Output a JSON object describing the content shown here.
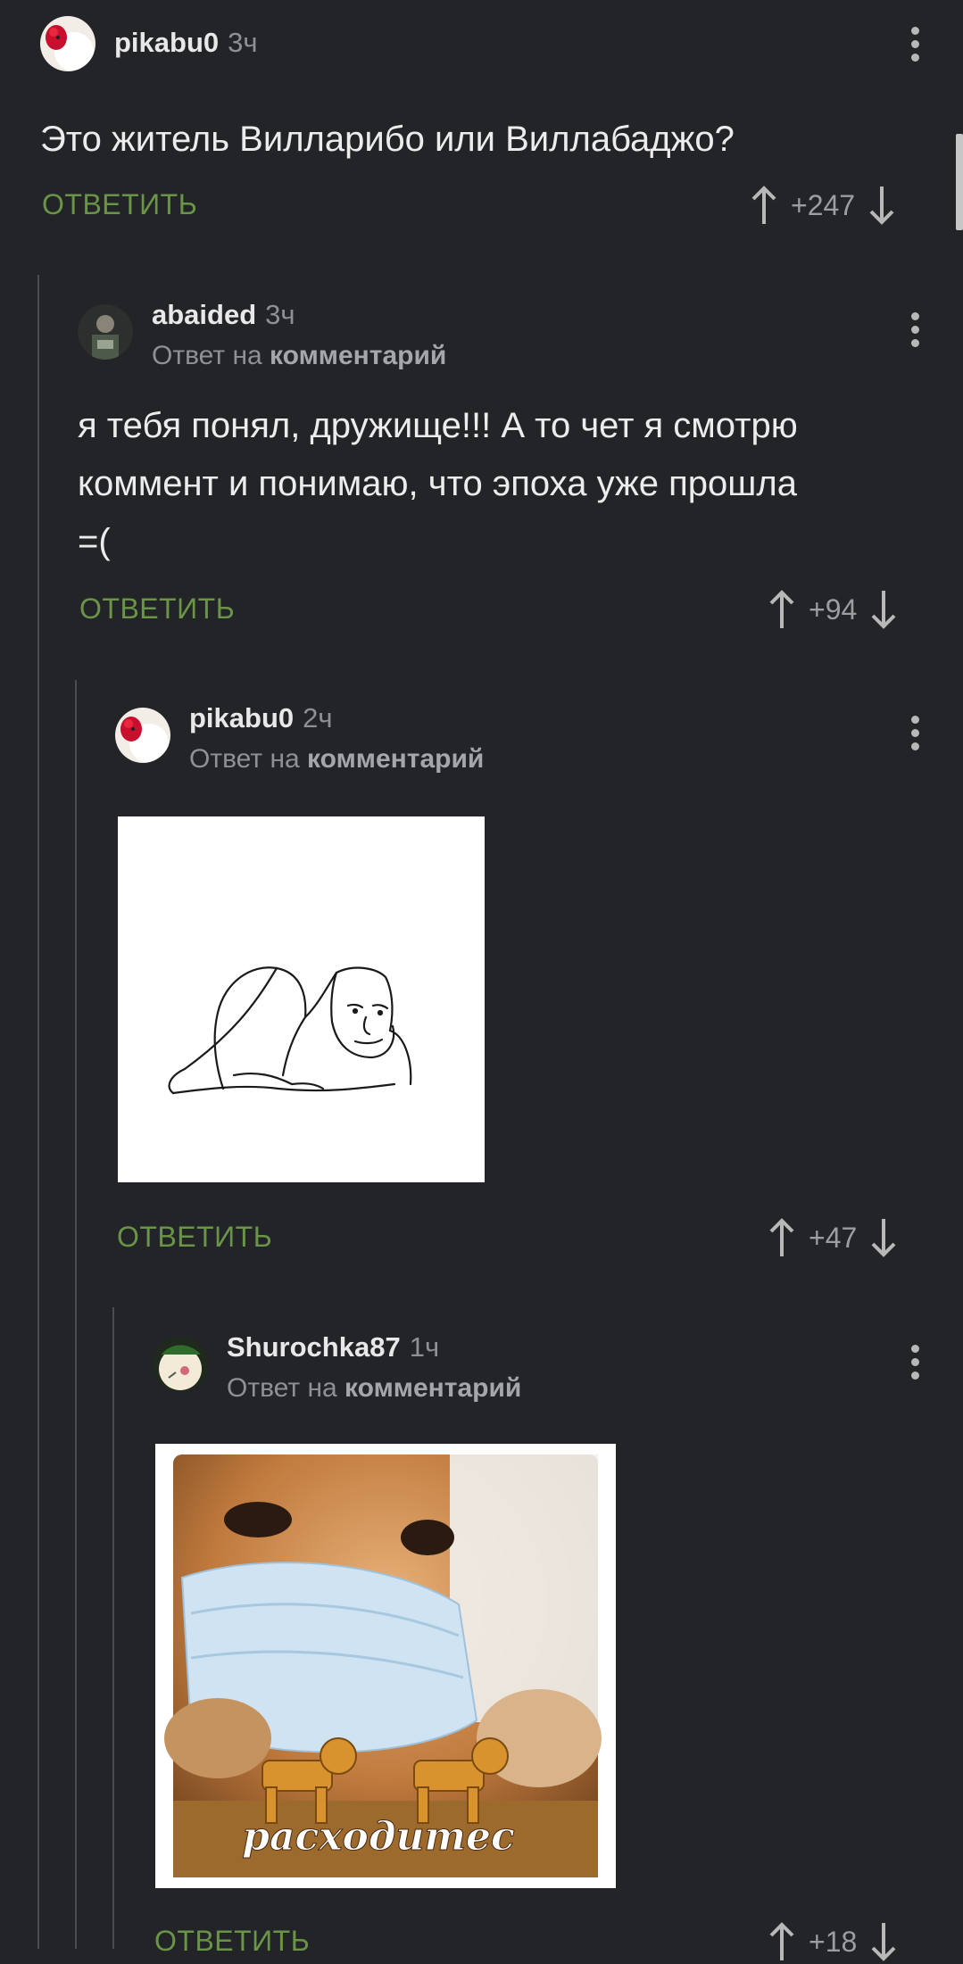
{
  "colors": {
    "background": "#222427",
    "accent_green": "#6a9447",
    "muted": "#8e9094",
    "thread_line": "#4a4c50"
  },
  "comments": [
    {
      "username": "pikabu0",
      "time": "3ч",
      "text": "Это житель Вилларибо или Виллабаджо?",
      "reply_label": "ОТВЕТИТЬ",
      "score": "+247"
    },
    {
      "username": "abaided",
      "time": "3ч",
      "reply_prefix": "Ответ на",
      "reply_target": "комментарий",
      "text_lines": [
        "я тебя понял, дружище!!! А то чет я смотрю",
        "коммент и понимаю, что эпоха уже прошла",
        "=("
      ],
      "reply_label": "ОТВЕТИТЬ",
      "score": "+94"
    },
    {
      "username": "pikabu0",
      "time": "2ч",
      "reply_prefix": "Ответ на",
      "reply_target": "комментарий",
      "image": "hug-meme-drawing",
      "reply_label": "ОТВЕТИТЬ",
      "score": "+47"
    },
    {
      "username": "Shurochka87",
      "time": "1ч",
      "reply_prefix": "Ответ на",
      "reply_target": "комментарий",
      "image": "dog-mask-meme",
      "image_caption": "расходитес",
      "reply_label": "ОТВЕТИТЬ",
      "score": "+18"
    }
  ],
  "icons": {
    "upvote": "arrow-up-icon",
    "downvote": "arrow-down-icon",
    "menu": "more-vertical-icon"
  }
}
